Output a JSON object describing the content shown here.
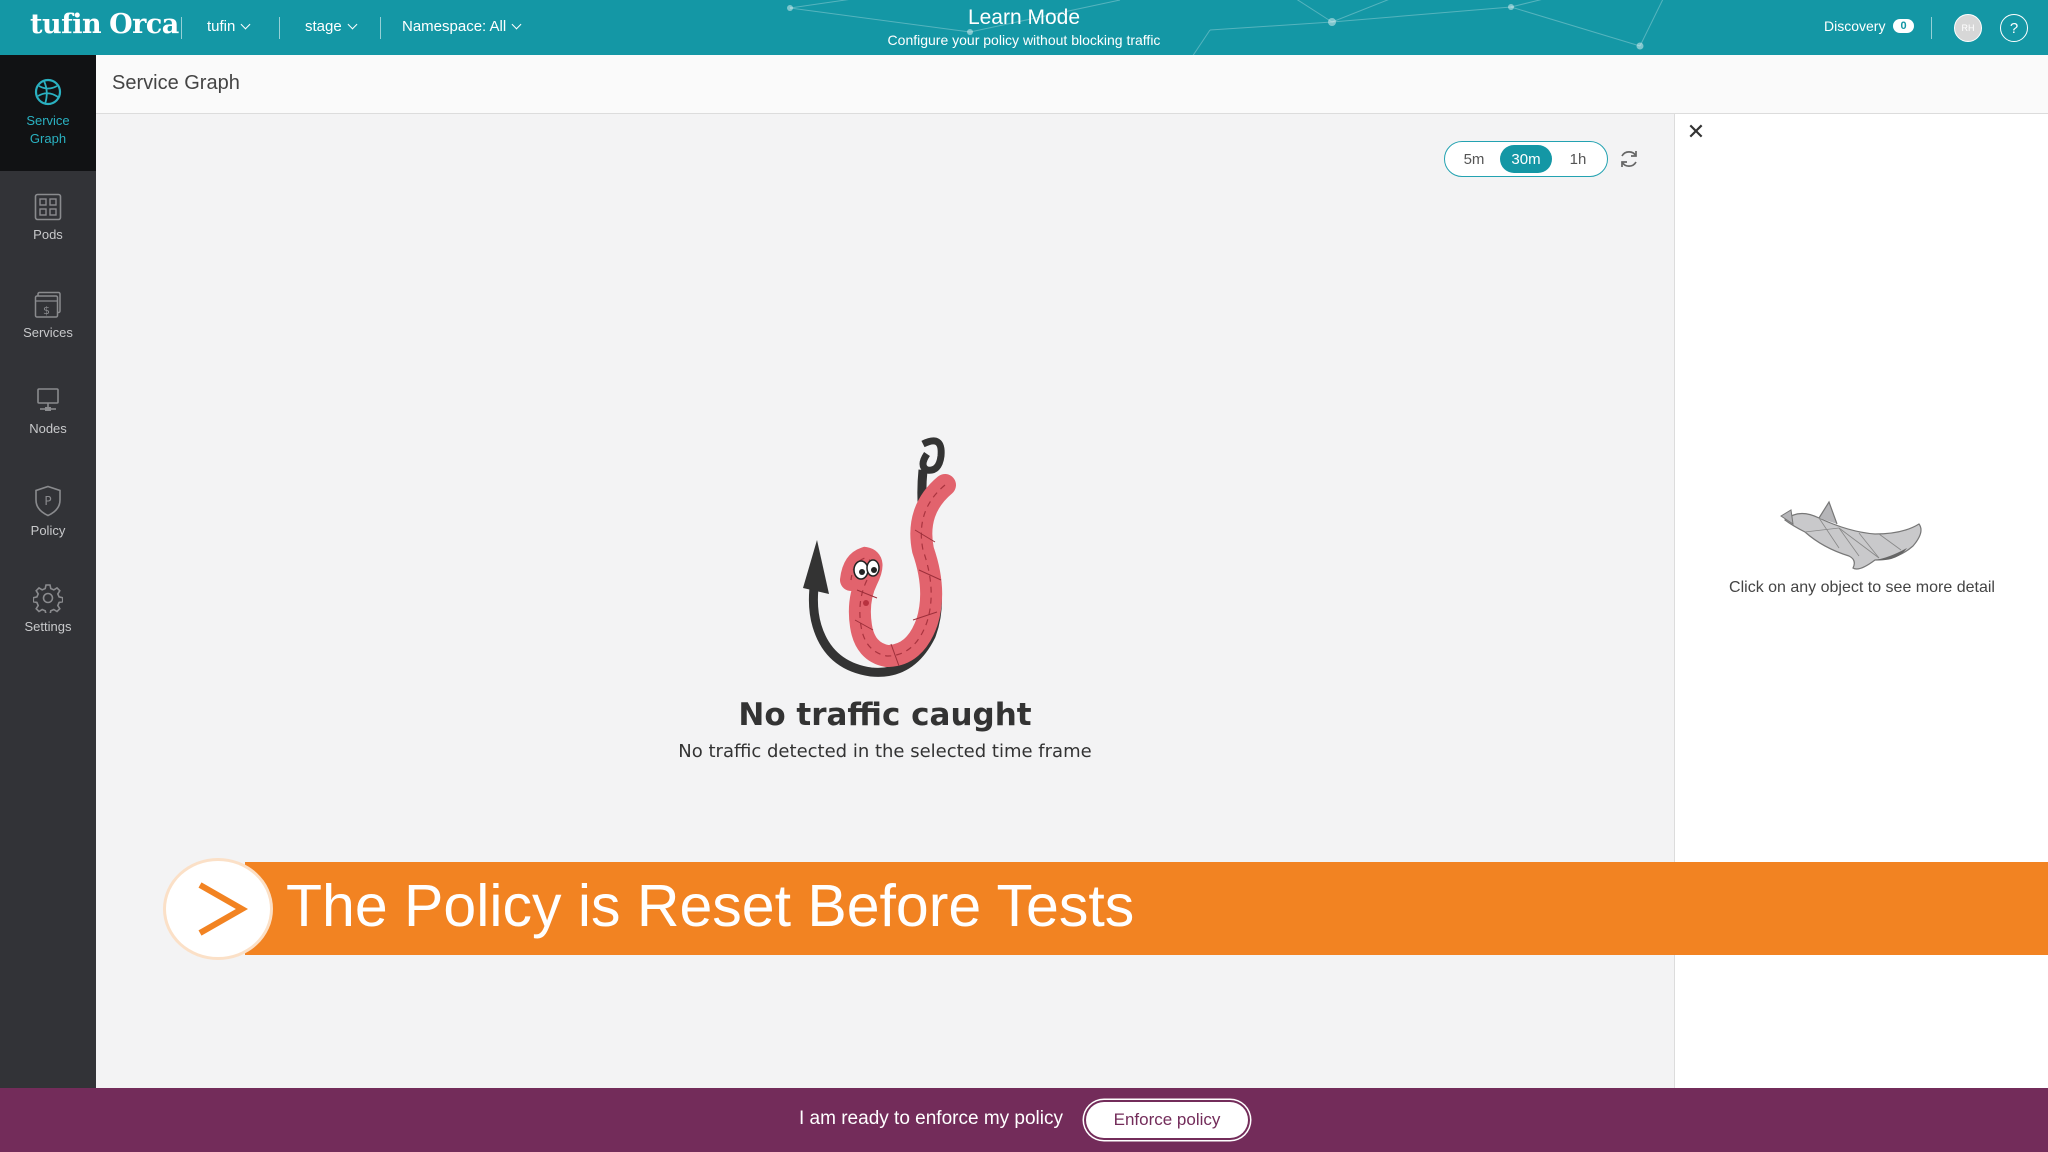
{
  "topbar": {
    "brand_part1": "tufin",
    "brand_part2": "Orca",
    "account_selector": "tufin",
    "cluster_selector": "stage",
    "namespace_selector": "Namespace: All",
    "mode_title": "Learn Mode",
    "mode_subtitle": "Configure your policy without blocking traffic",
    "discovery_label": "Discovery",
    "discovery_count": "0",
    "avatar_initials": "RH",
    "help_label": "?"
  },
  "sidebar": {
    "items": [
      {
        "label_line1": "Service",
        "label_line2": "Graph",
        "icon": "service-graph-icon",
        "active": true
      },
      {
        "label": "Pods",
        "icon": "pods-icon"
      },
      {
        "label": "Services",
        "icon": "services-icon"
      },
      {
        "label": "Nodes",
        "icon": "nodes-icon"
      },
      {
        "label": "Policy",
        "icon": "policy-icon"
      },
      {
        "label": "Settings",
        "icon": "gear-icon"
      }
    ]
  },
  "header": {
    "title": "Service Graph"
  },
  "time_range": {
    "options": [
      "5m",
      "30m",
      "1h"
    ],
    "selected": "30m"
  },
  "empty_state": {
    "title": "No traffic caught",
    "subtitle": "No traffic detected in the selected time frame"
  },
  "detail_panel": {
    "close_label": "✕",
    "hint": "Click on any object to see more detail"
  },
  "banner": {
    "text": "The Policy is Reset Before Tests"
  },
  "enforce": {
    "prompt": "I am ready to enforce my policy",
    "button_label": "Enforce policy"
  },
  "colors": {
    "topbar": "#1497a5",
    "sidebar": "#323337",
    "accent": "#2ab1c1",
    "banner": "#f28322",
    "enforce_bar": "#732c5a"
  }
}
